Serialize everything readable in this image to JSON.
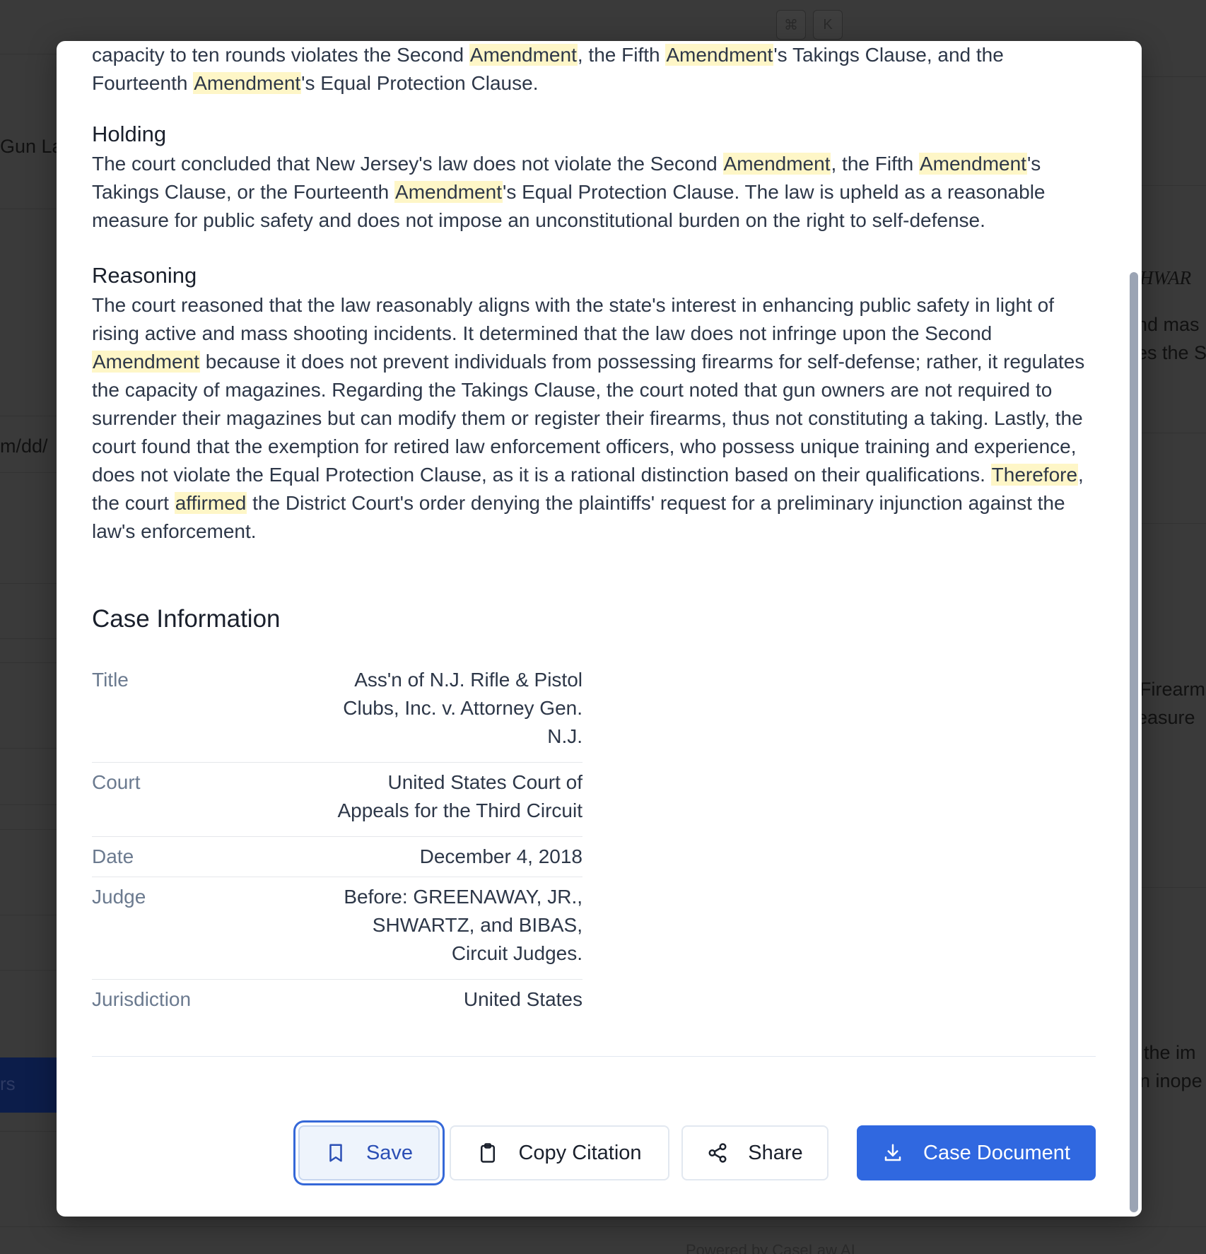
{
  "background": {
    "kbd_keys": [
      "⌘",
      "K"
    ],
    "left_fragments": [
      "Gun La",
      "m/dd/",
      "rs"
    ],
    "right_fragments": [
      "HWAR",
      "nd mas",
      "es the S",
      "Firearm",
      "easure",
      "the im",
      "n inope"
    ],
    "footer": "Powered by CaseLaw AI"
  },
  "summary": {
    "intro_parts": [
      "capacity to ten rounds violates the Second ",
      "Amendment",
      ", the Fifth ",
      "Amendment",
      "'s Takings Clause, and the Fourteenth ",
      "Amendment",
      "'s Equal Protection Clause."
    ],
    "holding_heading": "Holding",
    "holding_parts": [
      "The court concluded that New Jersey's law does not violate the Second ",
      "Amendment",
      ", the Fifth ",
      "Amendment",
      "'s Takings Clause, or the Fourteenth ",
      "Amendment",
      "'s Equal Protection Clause. The law is upheld as a reasonable measure for public safety and does not impose an unconstitutional burden on the right to self-defense."
    ],
    "reasoning_heading": "Reasoning",
    "reasoning_parts": [
      "The court reasoned that the law reasonably aligns with the state's interest in enhancing public safety in light of rising active and mass shooting incidents. It determined that the law does not infringe upon the Second ",
      "Amendment",
      " because it does not prevent individuals from possessing firearms for self-defense; rather, it regulates the capacity of magazines. Regarding the Takings Clause, the court noted that gun owners are not required to surrender their magazines but can modify them or register their firearms, thus not constituting a taking. Lastly, the court found that the exemption for retired law enforcement officers, who possess unique training and experience, does not violate the Equal Protection Clause, as it is a rational distinction based on their qualifications. ",
      "Therefore",
      ", the court ",
      "affirmed",
      " the District Court's order denying the plaintiffs' request for a preliminary injunction against the law's enforcement."
    ]
  },
  "case_info": {
    "heading": "Case Information",
    "rows": [
      {
        "label": "Title",
        "value": "Ass'n of N.J. Rifle & Pistol Clubs, Inc. v. Attorney Gen. N.J."
      },
      {
        "label": "Court",
        "value": "United States Court of Appeals for the Third Circuit"
      },
      {
        "label": "Date",
        "value": "December 4, 2018"
      },
      {
        "label": "Judge",
        "value": "Before: GREENAWAY, JR., SHWARTZ, and BIBAS, Circuit Judges."
      },
      {
        "label": "Jurisdiction",
        "value": "United States"
      }
    ]
  },
  "actions": {
    "save_label": "Save",
    "copy_label": "Copy Citation",
    "share_label": "Share",
    "document_label": "Case Document"
  },
  "colors": {
    "highlight": "#fef6c7",
    "primary": "#3068e0",
    "focus_ring": "#3568d8"
  }
}
